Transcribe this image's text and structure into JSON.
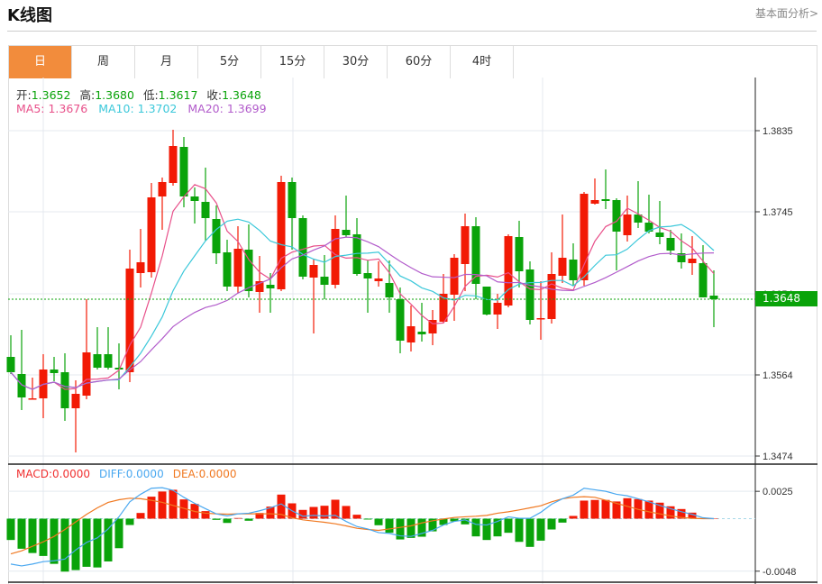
{
  "header": {
    "title": "K线图",
    "link": "基本面分析>"
  },
  "tabs": [
    {
      "label": "日",
      "active": true
    },
    {
      "label": "周"
    },
    {
      "label": "月"
    },
    {
      "label": "5分"
    },
    {
      "label": "15分"
    },
    {
      "label": "30分"
    },
    {
      "label": "60分"
    },
    {
      "label": "4时"
    }
  ],
  "ohlc": {
    "open_label": "开:",
    "open": "1.3652",
    "high_label": "高:",
    "high": "1.3680",
    "low_label": "低:",
    "low": "1.3617",
    "close_label": "收:",
    "close": "1.3648"
  },
  "ma": {
    "ma5": "MA5: 1.3676",
    "ma10": "MA10: 1.3702",
    "ma20": "MA20: 1.3699"
  },
  "macd_legend": {
    "macd": "MACD:0.0000",
    "diff": "DIFF:0.0000",
    "dea": "DEA:0.0000"
  },
  "current_price": "1.3648",
  "colors": {
    "up": "#F21A05",
    "down": "#0AA30A",
    "ma5": "#E8508A",
    "ma10": "#3CC8DA",
    "ma20": "#B25CCB",
    "macd": "#F03030",
    "diff": "#4AA8F0",
    "dea": "#F07820",
    "active_tab": "#F28C3C"
  },
  "chart_data": [
    {
      "type": "candlestick",
      "y_ticks": [
        "1.3835",
        "1.3745",
        "1.3654",
        "1.3564",
        "1.3474"
      ],
      "ylim": [
        1.3465,
        1.388
      ],
      "grid": true,
      "candles": [
        [
          1.3584,
          1.3608,
          1.3565,
          1.3567
        ],
        [
          1.3565,
          1.3614,
          1.3525,
          1.3539
        ],
        [
          1.3537,
          1.3561,
          1.3537,
          1.3538
        ],
        [
          1.3538,
          1.3587,
          1.3516,
          1.357
        ],
        [
          1.357,
          1.3584,
          1.3557,
          1.3566
        ],
        [
          1.3567,
          1.3588,
          1.3513,
          1.3527
        ],
        [
          1.3527,
          1.3558,
          1.3478,
          1.3543
        ],
        [
          1.3541,
          1.3648,
          1.3537,
          1.3589
        ],
        [
          1.3587,
          1.3617,
          1.357,
          1.3572
        ],
        [
          1.3587,
          1.3617,
          1.357,
          1.3572
        ],
        [
          1.3572,
          1.3599,
          1.3548,
          1.357
        ],
        [
          1.3567,
          1.3703,
          1.3556,
          1.3682
        ],
        [
          1.3677,
          1.3726,
          1.3661,
          1.3689
        ],
        [
          1.3678,
          1.3777,
          1.3672,
          1.3761
        ],
        [
          1.3762,
          1.3783,
          1.3725,
          1.3778
        ],
        [
          1.3777,
          1.3836,
          1.3774,
          1.3818
        ],
        [
          1.3817,
          1.3828,
          1.375,
          1.3762
        ],
        [
          1.3762,
          1.3772,
          1.3732,
          1.3757
        ],
        [
          1.3756,
          1.3794,
          1.3713,
          1.3738
        ],
        [
          1.3737,
          1.3752,
          1.3687,
          1.3699
        ],
        [
          1.37,
          1.3714,
          1.3657,
          1.3662
        ],
        [
          1.3662,
          1.3729,
          1.3655,
          1.3704
        ],
        [
          1.3703,
          1.3731,
          1.365,
          1.3657
        ],
        [
          1.3656,
          1.3696,
          1.3633,
          1.3668
        ],
        [
          1.3664,
          1.3677,
          1.3633,
          1.366
        ],
        [
          1.3659,
          1.3785,
          1.3657,
          1.3778
        ],
        [
          1.3778,
          1.3783,
          1.3703,
          1.3738
        ],
        [
          1.3738,
          1.3741,
          1.367,
          1.3673
        ],
        [
          1.3672,
          1.3692,
          1.361,
          1.3686
        ],
        [
          1.3673,
          1.3697,
          1.3648,
          1.3664
        ],
        [
          1.3664,
          1.3741,
          1.366,
          1.3726
        ],
        [
          1.3725,
          1.3763,
          1.3717,
          1.3719
        ],
        [
          1.372,
          1.3738,
          1.3674,
          1.3676
        ],
        [
          1.3677,
          1.3691,
          1.3633,
          1.3671
        ],
        [
          1.3668,
          1.369,
          1.3662,
          1.3671
        ],
        [
          1.3666,
          1.3691,
          1.3633,
          1.365
        ],
        [
          1.3648,
          1.3661,
          1.3588,
          1.3602
        ],
        [
          1.36,
          1.3641,
          1.359,
          1.3618
        ],
        [
          1.3612,
          1.3644,
          1.3601,
          1.3609
        ],
        [
          1.361,
          1.3636,
          1.3597,
          1.3625
        ],
        [
          1.3623,
          1.3676,
          1.3622,
          1.3654
        ],
        [
          1.3653,
          1.3698,
          1.3624,
          1.3694
        ],
        [
          1.3687,
          1.3743,
          1.3657,
          1.3729
        ],
        [
          1.3729,
          1.3739,
          1.3648,
          1.3665
        ],
        [
          1.3662,
          1.3662,
          1.363,
          1.3631
        ],
        [
          1.3631,
          1.3654,
          1.3615,
          1.3644
        ],
        [
          1.3641,
          1.372,
          1.3639,
          1.3718
        ],
        [
          1.3717,
          1.3735,
          1.3661,
          1.3679
        ],
        [
          1.3681,
          1.369,
          1.362,
          1.3625
        ],
        [
          1.3626,
          1.3668,
          1.3603,
          1.3627
        ],
        [
          1.3626,
          1.37,
          1.3621,
          1.3676
        ],
        [
          1.3674,
          1.3742,
          1.3666,
          1.3694
        ],
        [
          1.3692,
          1.371,
          1.3663,
          1.3669
        ],
        [
          1.3669,
          1.3767,
          1.3663,
          1.3765
        ],
        [
          1.3754,
          1.3782,
          1.3753,
          1.3758
        ],
        [
          1.3759,
          1.3792,
          1.3748,
          1.3757
        ],
        [
          1.3758,
          1.376,
          1.368,
          1.3723
        ],
        [
          1.3719,
          1.3763,
          1.3712,
          1.3742
        ],
        [
          1.3742,
          1.3779,
          1.3727,
          1.3733
        ],
        [
          1.3733,
          1.3764,
          1.3721,
          1.3723
        ],
        [
          1.3722,
          1.3757,
          1.3709,
          1.3717
        ],
        [
          1.3716,
          1.3725,
          1.3697,
          1.3702
        ],
        [
          1.3699,
          1.3721,
          1.3682,
          1.3689
        ],
        [
          1.3688,
          1.3718,
          1.3675,
          1.3693
        ],
        [
          1.3688,
          1.3708,
          1.365,
          1.365
        ],
        [
          1.3652,
          1.368,
          1.3617,
          1.3648
        ]
      ],
      "moving_averages": [
        5,
        10,
        20
      ]
    },
    {
      "type": "bar+line",
      "y_ticks": [
        "0.0025",
        "-0.0048"
      ],
      "macd": [
        -0.00195,
        -0.00275,
        -0.00314,
        -0.00341,
        -0.00413,
        -0.00484,
        -0.0047,
        -0.0044,
        -0.00446,
        -0.00391,
        -0.0027,
        -0.00058,
        0.00052,
        0.00201,
        0.00248,
        0.00264,
        0.00176,
        0.00135,
        0.00069,
        -0.00011,
        -0.00039,
        6e-05,
        -0.00019,
        0.00052,
        0.0011,
        0.0022,
        0.0014,
        0.0008,
        0.00107,
        0.00118,
        0.00173,
        0.00116,
        0.00036,
        -8e-05,
        -0.0006,
        -0.00129,
        -0.0019,
        -0.00176,
        -0.00165,
        -0.00116,
        -0.00058,
        -0.00025,
        -0.00052,
        -0.00162,
        -0.00195,
        -0.00162,
        -0.00129,
        -0.00212,
        -0.00258,
        -0.00201,
        -0.00099,
        -0.00036,
        0.00025,
        0.00165,
        0.00171,
        0.00171,
        0.00157,
        0.00187,
        0.00179,
        0.00165,
        0.00146,
        0.00113,
        0.00088,
        0.00055,
        3e-05,
        0
      ],
      "diff": [
        -0.00415,
        -0.00432,
        -0.00415,
        -0.00393,
        -0.00385,
        -0.00369,
        -0.00286,
        -0.00217,
        -0.00176,
        -0.00094,
        0.00017,
        0.00154,
        0.00223,
        0.00278,
        0.00283,
        0.00259,
        0.00195,
        0.0014,
        0.00091,
        0.00044,
        0.00025,
        0.00044,
        0.0005,
        0.00072,
        0.00099,
        0.00135,
        0.00072,
        0.00022,
        0.0003,
        0.00025,
        0.0003,
        -0.00025,
        -0.00072,
        -0.00094,
        -0.00127,
        -0.00135,
        -0.00157,
        -0.00162,
        -0.00135,
        -0.00107,
        -0.00058,
        -0.00025,
        -0.00011,
        -0.00052,
        -0.00058,
        -0.00025,
        0.00017,
        3e-05,
        3e-05,
        0.00058,
        0.00132,
        0.00182,
        0.00215,
        0.00278,
        0.00264,
        0.0025,
        0.00223,
        0.00209,
        0.00182,
        0.00154,
        0.00121,
        0.00091,
        0.00063,
        0.00039,
        8e-05,
        0
      ],
      "dea": [
        -0.00322,
        -0.00294,
        -0.00253,
        -0.00212,
        -0.00162,
        -0.00099,
        -0.0003,
        0.00039,
        0.00099,
        0.00149,
        0.00173,
        0.00187,
        0.00182,
        0.00168,
        0.00149,
        0.00121,
        0.00094,
        0.00066,
        0.0005,
        0.00044,
        0.00041,
        0.00044,
        0.00044,
        0.00044,
        0.00044,
        0.00039,
        8e-05,
        -0.00011,
        -0.00022,
        -0.00033,
        -0.00047,
        -0.00066,
        -0.00088,
        -0.00099,
        -0.00107,
        -0.00094,
        -0.0008,
        -0.00066,
        -0.00039,
        -0.00019,
        -3e-05,
        0.00011,
        0.00017,
        0.00022,
        0.0003,
        0.0005,
        0.00063,
        0.0008,
        0.00099,
        0.00118,
        0.00154,
        0.00182,
        0.00195,
        0.00201,
        0.00195,
        0.00168,
        0.0014,
        0.00113,
        0.00085,
        0.00063,
        0.00044,
        0.00025,
        0.00011,
        3e-05,
        0,
        0
      ]
    }
  ]
}
